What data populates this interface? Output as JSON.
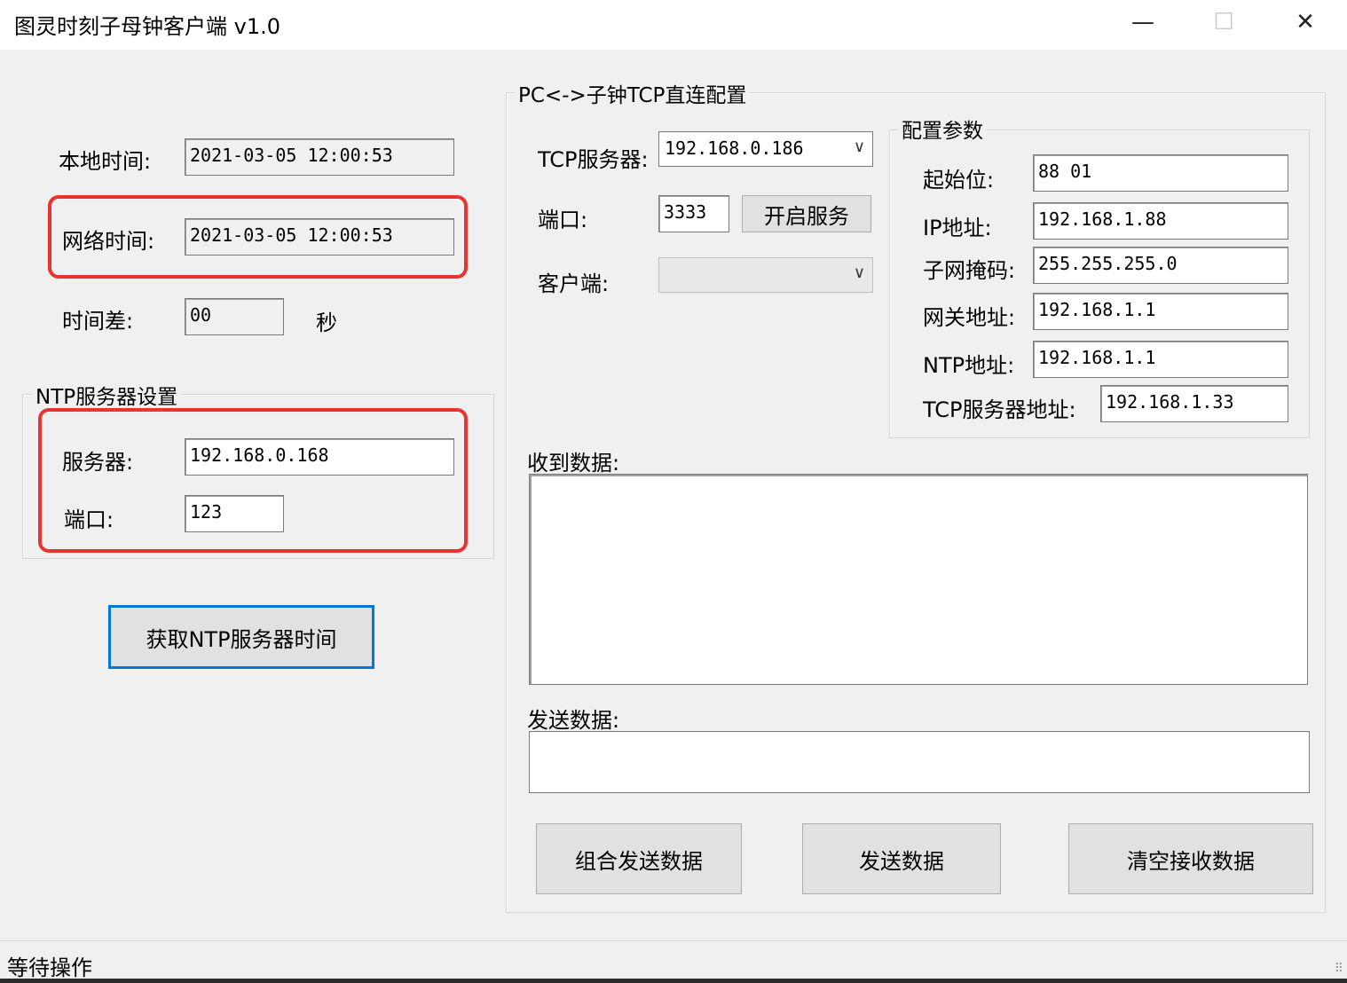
{
  "window": {
    "title": "图灵时刻子母钟客户端 v1.0",
    "min_glyph": "—",
    "max_glyph": "☐",
    "close_glyph": "✕"
  },
  "left": {
    "local_time_label": "本地时间:",
    "local_time_value": "2021-03-05 12:00:53",
    "net_time_label": "网络时间:",
    "net_time_value": "2021-03-05 12:00:53",
    "diff_label": "时间差:",
    "diff_value": "00",
    "diff_unit": "秒",
    "ntp_group_title": "NTP服务器设置",
    "server_label": "服务器:",
    "server_value": "192.168.0.168",
    "port_label": "端口:",
    "port_value": "123",
    "get_ntp_button": "获取NTP服务器时间"
  },
  "right": {
    "group_title": "PC<->子钟TCP直连配置",
    "tcp_server_label": "TCP服务器:",
    "tcp_server_value": "192.168.0.186",
    "port_label": "端口:",
    "port_value": "3333",
    "start_service_button": "开启服务",
    "client_label": "客户端:",
    "client_value": "",
    "config_group_title": "配置参数",
    "start_bit_label": "起始位:",
    "start_bit_value": "88 01",
    "ip_label": "IP地址:",
    "ip_value": "192.168.1.88",
    "mask_label": "子网掩码:",
    "mask_value": "255.255.255.0",
    "gateway_label": "网关地址:",
    "gateway_value": "192.168.1.1",
    "ntp_addr_label": "NTP地址:",
    "ntp_addr_value": "192.168.1.1",
    "tcp_addr_label": "TCP服务器地址:",
    "tcp_addr_value": "192.168.1.33",
    "recv_label": "收到数据:",
    "send_label": "发送数据:",
    "combine_send_button": "组合发送数据",
    "send_button": "发送数据",
    "clear_button": "清空接收数据"
  },
  "status": {
    "text": "等待操作"
  },
  "colors": {
    "highlight_box": "#e8342f",
    "focus_border": "#0078d7"
  }
}
